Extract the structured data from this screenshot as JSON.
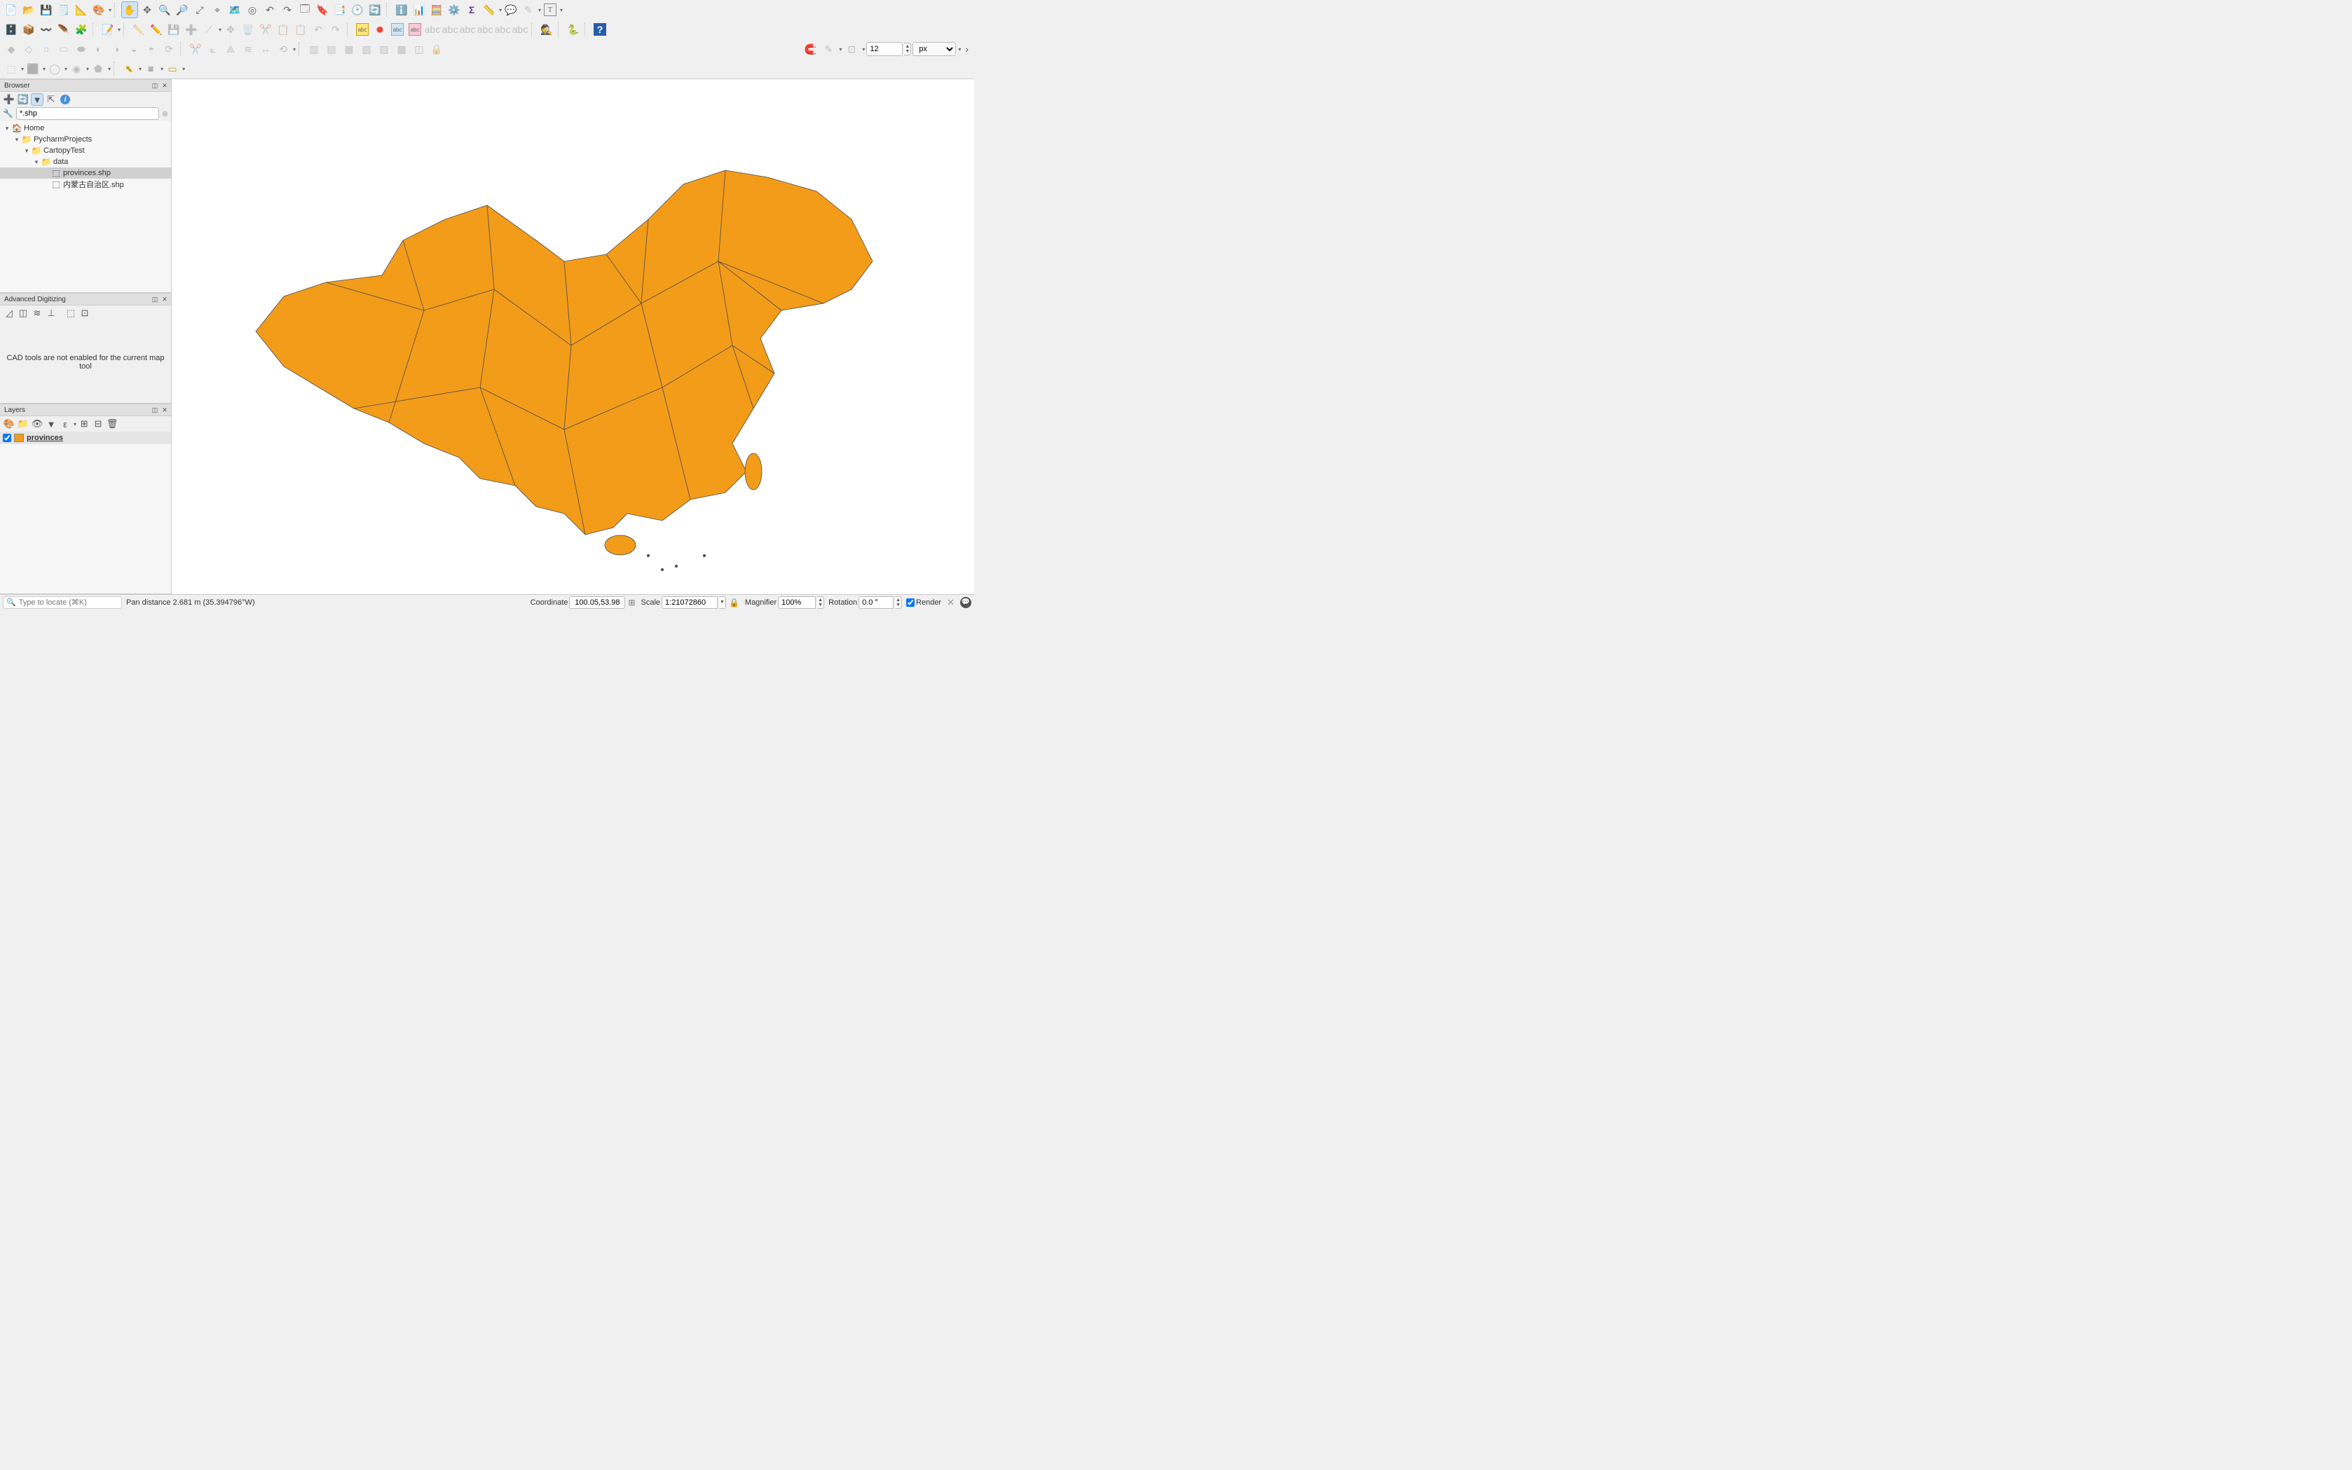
{
  "panels": {
    "browser": {
      "title": "Browser",
      "filter_value": "*.shp",
      "tree": [
        {
          "depth": 0,
          "toggle": "▾",
          "icon": "🏠",
          "label": "Home",
          "selected": false
        },
        {
          "depth": 1,
          "toggle": "▾",
          "icon": "📁",
          "label": "PycharmProjects",
          "selected": false
        },
        {
          "depth": 2,
          "toggle": "▾",
          "icon": "📁",
          "label": "CartopyTest",
          "selected": false
        },
        {
          "depth": 3,
          "toggle": "▾",
          "icon": "📁",
          "label": "data",
          "selected": false
        },
        {
          "depth": 4,
          "toggle": "",
          "icon": "⬚",
          "label": "provinces.shp",
          "selected": true
        },
        {
          "depth": 4,
          "toggle": "",
          "icon": "⬚",
          "label": "内蒙古自治区.shp",
          "selected": false
        }
      ]
    },
    "digitizing": {
      "title": "Advanced Digitizing",
      "message": "CAD tools are not enabled for the current map tool"
    },
    "layers": {
      "title": "Layers",
      "items": [
        {
          "checked": true,
          "swatch": "#f39c1a",
          "name": "provinces"
        }
      ]
    }
  },
  "toolbar3": {
    "size_value": "12",
    "unit_value": "px"
  },
  "status": {
    "locator_placeholder": "Type to locate (⌘K)",
    "pan_message": "Pan distance 2.681 m (35.394796°W)",
    "coordinate_label": "Coordinate",
    "coordinate_value": "100.05,53.98",
    "scale_label": "Scale",
    "scale_value": "1:21072860",
    "magnifier_label": "Magnifier",
    "magnifier_value": "100%",
    "rotation_label": "Rotation",
    "rotation_value": "0.0 °",
    "render_label": "Render"
  },
  "map": {
    "feature_fill": "#f39c1a",
    "feature_stroke": "#4a4a4a"
  }
}
